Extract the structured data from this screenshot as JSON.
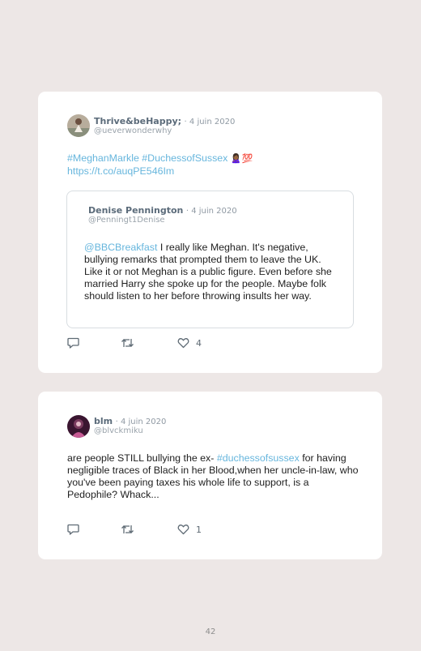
{
  "tweets": [
    {
      "author_name": "Thrive&beHappy;",
      "date": "· 4 juin 2020",
      "handle": "@ueverwonderwhy",
      "text_hashtags": "#MeghanMarkle #DuchessofSussex",
      "text_emoji": "🙎🏾‍♀️💯",
      "text_url": "https://t.co/auqPE546Im",
      "quoted": {
        "author_name": "Denise Pennington",
        "date": "· 4 juin 2020",
        "handle": "@Penningt1Denise",
        "mention": "@BBCBreakfast",
        "text": " I really like Meghan. It's negative, bullying remarks that prompted them to leave the UK. Like it or not Meghan is a public figure. Even before she married Harry she spoke up for the people. Maybe folk should listen to her before throwing insults her way."
      },
      "like_count": "4"
    },
    {
      "author_name": "blm",
      "date": "· 4 juin 2020",
      "handle": "@blvckmiku",
      "text_before": "are people STILL bullying the ex- ",
      "text_hashtag": "#duchessofsussex",
      "text_after": " for having negligible traces of Black in her Blood,when her uncle-in-law, who you've been paying taxes his whole life to support, is a Pedophile? Whack...",
      "like_count": "1"
    }
  ],
  "page_number": "42",
  "colors": {
    "background": "#ede7e6",
    "card": "#ffffff",
    "link": "#67b6dd",
    "name": "#5b6b7a"
  }
}
